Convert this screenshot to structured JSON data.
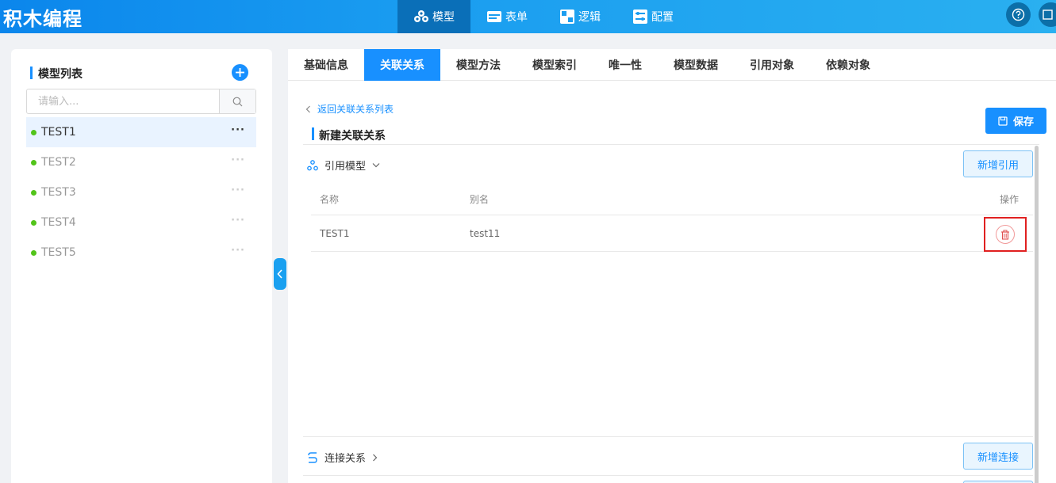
{
  "app": {
    "brand": "积木编程"
  },
  "nav": [
    {
      "label": "模型",
      "icon": "cubes-icon",
      "active": true
    },
    {
      "label": "表单",
      "icon": "form-icon",
      "active": false
    },
    {
      "label": "逻辑",
      "icon": "logic-icon",
      "active": false
    },
    {
      "label": "配置",
      "icon": "config-icon",
      "active": false
    }
  ],
  "sidebar": {
    "title": "模型列表",
    "search_placeholder": "请输入...",
    "items": [
      {
        "name": "TEST1",
        "more": "···"
      },
      {
        "name": "TEST2",
        "more": "···"
      },
      {
        "name": "TEST3",
        "more": "···"
      },
      {
        "name": "TEST4",
        "more": "···"
      },
      {
        "name": "TEST5",
        "more": "···"
      }
    ]
  },
  "tabs": [
    "基础信息",
    "关联关系",
    "模型方法",
    "模型索引",
    "唯一性",
    "模型数据",
    "引用对象",
    "依赖对象"
  ],
  "main": {
    "back_label": "返回关联关系列表",
    "section_title": "新建关联关系",
    "save_label": "保存",
    "ref_section": {
      "title": "引用模型",
      "add_label": "新增引用",
      "columns": {
        "name": "名称",
        "alias": "别名",
        "action": "操作"
      },
      "rows": [
        {
          "name": "TEST1",
          "alias": "test11"
        }
      ]
    },
    "conn_section": {
      "title": "连接关系",
      "add_label": "新增连接"
    }
  },
  "colors": {
    "primary": "#1890ff",
    "status_dot": "#52c41a",
    "highlight": "#e02020"
  }
}
